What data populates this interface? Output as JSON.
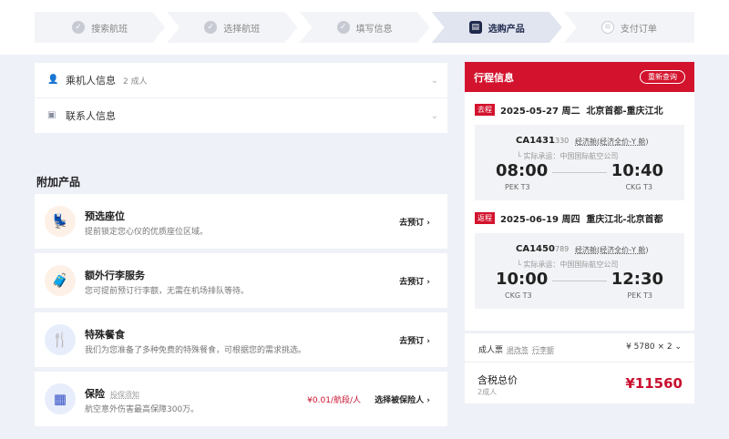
{
  "steps": [
    {
      "label": "搜索航班",
      "state": "done"
    },
    {
      "label": "选择航班",
      "state": "done"
    },
    {
      "label": "填写信息",
      "state": "done"
    },
    {
      "label": "选购产品",
      "state": "active"
    },
    {
      "label": "支付订单",
      "state": "pending"
    }
  ],
  "passenger": {
    "title": "乘机人信息",
    "count": "2 成人"
  },
  "contact": {
    "title": "联系人信息"
  },
  "addons": {
    "title": "附加产品",
    "items": [
      {
        "title": "预选座位",
        "desc": "提前锁定您心仪的优质座位区域。",
        "action": "去预订"
      },
      {
        "title": "额外行李服务",
        "desc": "您可提前预订行李额，无需在机场排队等待。",
        "action": "去预订"
      },
      {
        "title": "特殊餐食",
        "desc": "我们为您准备了多种免费的特殊餐食，可根据您的需求挑选。",
        "action": "去预订"
      },
      {
        "title": "保险",
        "hint": "投保须知",
        "desc": "航空意外伤害最高保障300万。",
        "price": "¥0.01/航段/人",
        "action": "选择被保险人"
      }
    ]
  },
  "itinerary": {
    "title": "行程信息",
    "requery": "重新查询",
    "legs": [
      {
        "tag": "去程",
        "date": "2025-05-27 周二",
        "route": "北京首都-重庆江北",
        "flight": "CA1431",
        "aircraft": "330",
        "cabin": "经济舱(经济全价-Y 舱)",
        "operator": "实际承运：中国国际航空公司",
        "dep_time": "08:00",
        "arr_time": "10:40",
        "dep_airport": "PEK T3",
        "arr_airport": "CKG T3"
      },
      {
        "tag": "返程",
        "date": "2025-06-19 周四",
        "route": "重庆江北-北京首都",
        "flight": "CA1450",
        "aircraft": "789",
        "cabin": "经济舱(经济全价-Y 舱)",
        "operator": "实际承运：中国国际航空公司",
        "dep_time": "10:00",
        "arr_time": "12:30",
        "dep_airport": "CKG T3",
        "arr_airport": "PEK T3"
      }
    ]
  },
  "fare": {
    "label": "成人票",
    "link1": "退改签",
    "link2": "行李额",
    "amount": "¥ 5780 × 2"
  },
  "total": {
    "label": "含税总价",
    "count": "2成人",
    "amount": "¥11560"
  },
  "colors": {
    "brand": "#d3132d",
    "price": "#c8102e",
    "navy": "#1f2a4d"
  }
}
